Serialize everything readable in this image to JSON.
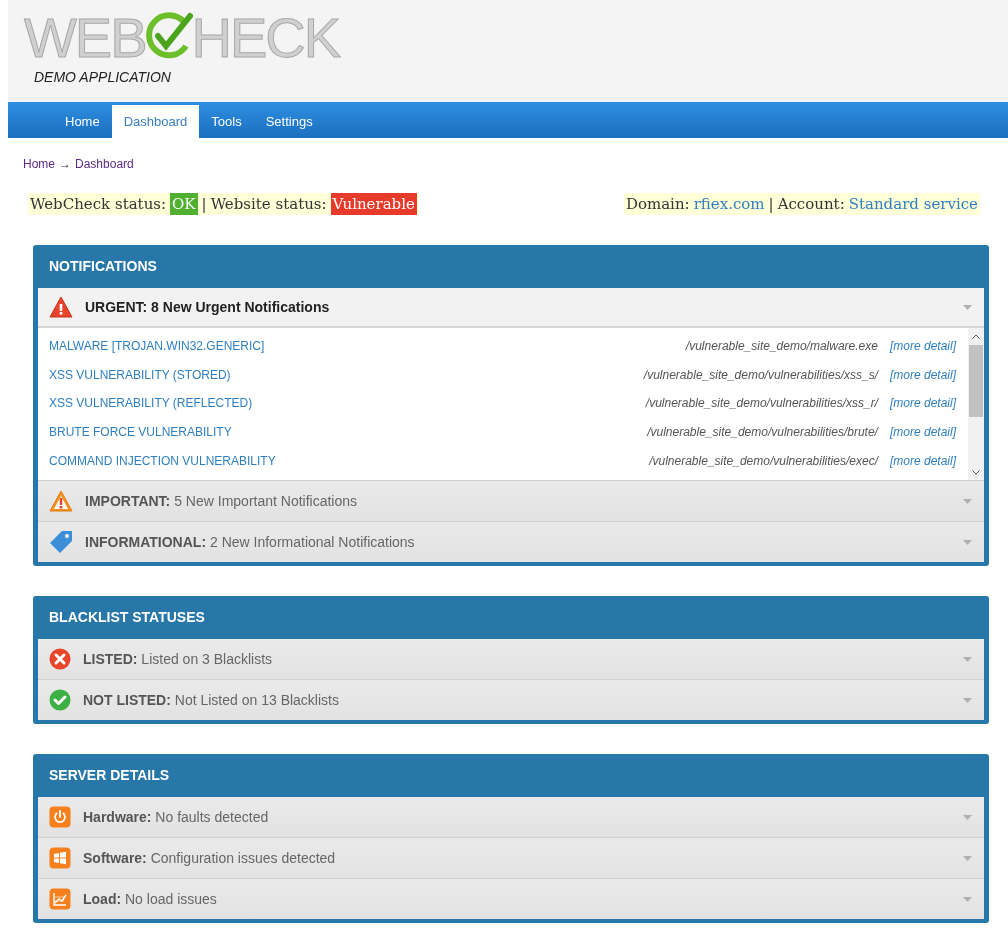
{
  "logo": {
    "before": "WEB",
    "after": "HECK",
    "subtitle": "DEMO APPLICATION"
  },
  "nav": [
    {
      "label": "Home",
      "selected": false
    },
    {
      "label": "Dashboard",
      "selected": true
    },
    {
      "label": "Tools",
      "selected": false
    },
    {
      "label": "Settings",
      "selected": false
    }
  ],
  "breadcrumb": {
    "items": [
      "Home",
      "Dashboard"
    ],
    "separator": "→"
  },
  "status": {
    "items": [
      {
        "label": "WebCheck status:",
        "value": "OK",
        "color": "#52b030"
      },
      {
        "label": "Website status:",
        "value": "Vulnerable",
        "color": "#e83a2a"
      }
    ],
    "separator": "|",
    "domain_label": "Domain:",
    "domain": "rfiex.com",
    "account_label": "Account:",
    "account": "Standard service"
  },
  "panels": [
    {
      "title": "NOTIFICATIONS",
      "sections": [
        {
          "kind": "urgent",
          "label": "URGENT: 8 New Urgent Notifications",
          "expanded": true,
          "items": [
            {
              "name": "MALWARE [TROJAN.WIN32.GENERIC]",
              "path": "/vulnerable_site_demo/malware.exe",
              "link": "[more detail]"
            },
            {
              "name": "XSS VULNERABILITY (STORED)",
              "path": "/vulnerable_site_demo/vulnerabilities/xss_s/",
              "link": "[more detail]"
            },
            {
              "name": "XSS VULNERABILITY (REFLECTED)",
              "path": "/vulnerable_site_demo/vulnerabilities/xss_r/",
              "link": "[more detail]"
            },
            {
              "name": "BRUTE FORCE VULNERABILITY",
              "path": "/vulnerable_site_demo/vulnerabilities/brute/",
              "link": "[more detail]"
            },
            {
              "name": "COMMAND INJECTION VULNERABILITY",
              "path": "/vulnerable_site_demo/vulnerabilities/exec/",
              "link": "[more detail]"
            }
          ]
        },
        {
          "kind": "important",
          "label": "IMPORTANT:",
          "detail": "5 New Important Notifications",
          "expanded": false
        },
        {
          "kind": "info",
          "label": "INFORMATIONAL:",
          "detail": "2 New Informational Notifications",
          "expanded": false
        }
      ]
    },
    {
      "title": "BLACKLIST STATUSES",
      "sections": [
        {
          "kind": "listed",
          "label": "LISTED:",
          "detail": "Listed on 3 Blacklists",
          "expanded": false
        },
        {
          "kind": "not-listed",
          "label": "NOT LISTED:",
          "detail": "Not Listed on 13 Blacklists",
          "expanded": false
        }
      ]
    },
    {
      "title": "SERVER DETAILS",
      "sections": [
        {
          "kind": "hardware",
          "label": "Hardware:",
          "detail": "No faults detected",
          "expanded": false
        },
        {
          "kind": "software",
          "label": "Software:",
          "detail": "Configuration issues detected",
          "expanded": false
        },
        {
          "kind": "load",
          "label": "Load:",
          "detail": "No load issues",
          "expanded": false
        }
      ]
    }
  ]
}
